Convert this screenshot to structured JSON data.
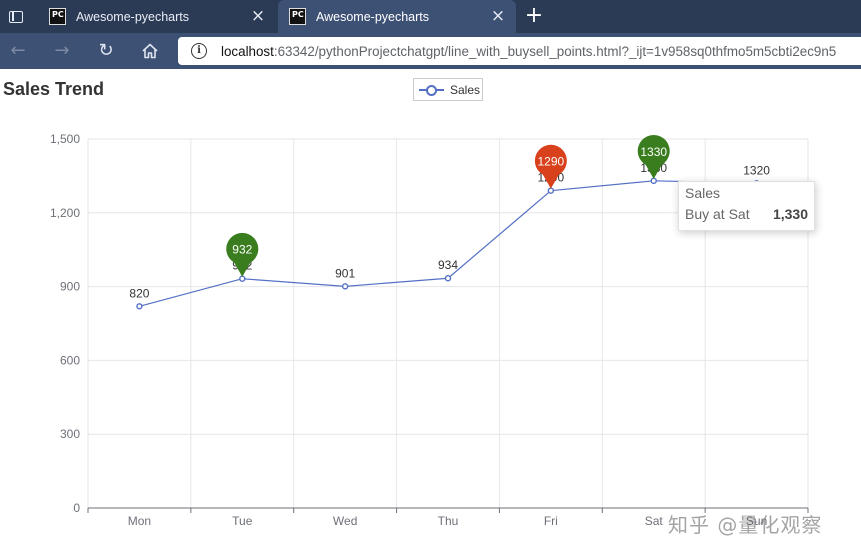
{
  "browser": {
    "tabs": [
      {
        "title": "Awesome-pyecharts",
        "active": false
      },
      {
        "title": "Awesome-pyecharts",
        "active": true
      }
    ],
    "tab_icon_text": "PC",
    "address": {
      "host": "localhost",
      "rest": ":63342/pythonProjectchatgpt/line_with_buysell_points.html?_ijt=1v958sq0thfmo5m5cbti2ec9n5"
    },
    "icons": [
      "window-icon",
      "close-icon",
      "plus-icon",
      "back-arrow-icon",
      "forward-arrow-icon",
      "reload-icon",
      "home-icon",
      "info-icon"
    ]
  },
  "chart_data": {
    "type": "line",
    "title": "Sales Trend",
    "categories": [
      "Mon",
      "Tue",
      "Wed",
      "Thu",
      "Fri",
      "Sat",
      "Sun"
    ],
    "series": [
      {
        "name": "Sales",
        "values": [
          820,
          932,
          901,
          934,
          1290,
          1330,
          1320
        ]
      }
    ],
    "ylim": [
      0,
      1500
    ],
    "yticks": [
      "0",
      "300",
      "600",
      "900",
      "1,200",
      "1,500"
    ],
    "grid": true,
    "legend_position": "top-center",
    "line_color": "#5470c6",
    "mark_points": [
      {
        "category": "Tue",
        "value": 932,
        "label": "932",
        "color": "#3a7d1f"
      },
      {
        "category": "Fri",
        "value": 1290,
        "label": "1290",
        "color": "#d9401c"
      },
      {
        "category": "Sat",
        "value": 1330,
        "label": "1330",
        "color": "#3a7d1f"
      }
    ],
    "tooltip": {
      "series": "Sales",
      "label": "Buy at Sat",
      "value": "1,330"
    }
  },
  "watermark": "知乎 @量化观察"
}
